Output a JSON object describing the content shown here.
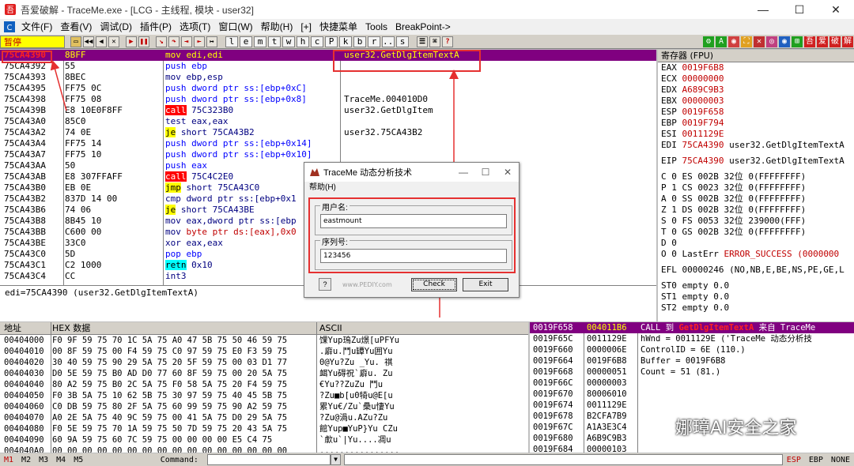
{
  "window": {
    "title": "吾爱破解 - TraceMe.exe - [LCG - 主线程, 模块 - user32]",
    "minimize": "—",
    "maximize": "☐",
    "close": "✕"
  },
  "menu": [
    "文件(F)",
    "查看(V)",
    "调试(D)",
    "插件(P)",
    "选项(T)",
    "窗口(W)",
    "帮助(H)",
    "[+]",
    "快捷菜单",
    "Tools",
    "BreakPoint->"
  ],
  "toolbar": {
    "status": "暂停",
    "nav_buttons": [
      "◀◀",
      "◀",
      "▶",
      "▶▶"
    ],
    "run_buttons": [
      "▶",
      "❚❚"
    ],
    "step_buttons": [
      "↘",
      "↷",
      "⇥",
      "⇤",
      "↦"
    ],
    "letters": [
      "l",
      "e",
      "m",
      "t",
      "w",
      "h",
      "c",
      "P",
      "k",
      "b",
      "r",
      "...",
      "s"
    ],
    "right_icons": [
      "☰",
      "⌘",
      "?"
    ],
    "plugin_icons": [
      "⚙",
      "A",
      "◉",
      "⛶",
      "✕",
      "◎",
      "◉",
      "⊞",
      "吾",
      "爱",
      "破",
      "解"
    ],
    "colors": {
      "purple_sel": "#800080",
      "addr_red": "#ff2020",
      "accent_red": "#e53030"
    }
  },
  "cpu": {
    "rows": [
      {
        "addr": "75CA4390",
        "hex": "8BFF",
        "mnem": "mov",
        "ops": "edi,edi",
        "comment": "user32.GetDlgItemTextA",
        "style": "nv",
        "sel": true
      },
      {
        "addr": "75CA4392",
        "hex": "55",
        "mnem": "push",
        "ops": "ebp",
        "comment": "",
        "style": "blue"
      },
      {
        "addr": "75CA4393",
        "hex": "8BEC",
        "mnem": "mov",
        "ops": "ebp,esp",
        "comment": "",
        "style": "nv"
      },
      {
        "addr": "75CA4395",
        "hex": "FF75 0C",
        "mnem": "push",
        "ops": "dword ptr ss:[ebp+0xC]",
        "comment": "",
        "style": "blue"
      },
      {
        "addr": "75CA4398",
        "hex": "FF75 08",
        "mnem": "push",
        "ops": "dword ptr ss:[ebp+0x8]",
        "comment": "TraceMe.004010D0",
        "style": "blue"
      },
      {
        "addr": "75CA439B",
        "hex": "E8 10E0F8FF",
        "mnem": "call",
        "ops": "75C323B0",
        "comment": "user32.GetDlgItem",
        "style": "call"
      },
      {
        "addr": "75CA43A0",
        "hex": "85C0",
        "mnem": "test",
        "ops": "eax,eax",
        "comment": "",
        "style": "nv"
      },
      {
        "addr": "75CA43A2",
        "hex": "74 0E",
        "mnem": "je",
        "ops": "short 75CA43B2",
        "comment": "user32.75CA43B2",
        "style": "jmp"
      },
      {
        "addr": "75CA43A4",
        "hex": "FF75 14",
        "mnem": "push",
        "ops": "dword ptr ss:[ebp+0x14]",
        "comment": "",
        "style": "blue"
      },
      {
        "addr": "75CA43A7",
        "hex": "FF75 10",
        "mnem": "push",
        "ops": "dword ptr ss:[ebp+0x10]",
        "comment": "",
        "style": "blue"
      },
      {
        "addr": "75CA43AA",
        "hex": "50",
        "mnem": "push",
        "ops": "eax",
        "comment": "",
        "style": "blue"
      },
      {
        "addr": "75CA43AB",
        "hex": "E8 307FFAFF",
        "mnem": "call",
        "ops": "75C4C2E0",
        "comment": "",
        "style": "call"
      },
      {
        "addr": "75CA43B0",
        "hex": "EB 0E",
        "mnem": "jmp",
        "ops": "short 75CA43C0",
        "comment": "",
        "style": "jmp"
      },
      {
        "addr": "75CA43B2",
        "hex": "837D 14 00",
        "mnem": "cmp",
        "ops": "dword ptr ss:[ebp+0x1",
        "comment": "",
        "style": "nv"
      },
      {
        "addr": "75CA43B6",
        "hex": "74 06",
        "mnem": "je",
        "ops": "short 75CA43BE",
        "comment": "",
        "style": "jmp"
      },
      {
        "addr": "75CA43B8",
        "hex": "8B45 10",
        "mnem": "mov",
        "ops": "eax,dword ptr ss:[ebp",
        "comment": "",
        "style": "nv"
      },
      {
        "addr": "75CA43BB",
        "hex": "C600 00",
        "mnem": "mov",
        "ops": "byte ptr ds:[eax],0x0",
        "comment": "",
        "style": "nvred"
      },
      {
        "addr": "75CA43BE",
        "hex": "33C0",
        "mnem": "xor",
        "ops": "eax,eax",
        "comment": "",
        "style": "nv"
      },
      {
        "addr": "75CA43C0",
        "hex": "5D",
        "mnem": "pop",
        "ops": "ebp",
        "comment": "",
        "style": "blue"
      },
      {
        "addr": "75CA43C1",
        "hex": "C2 1000",
        "mnem": "retn",
        "ops": "0x10",
        "comment": "",
        "style": "ret"
      },
      {
        "addr": "75CA43C4",
        "hex": "CC",
        "mnem": "int3",
        "ops": "",
        "comment": "",
        "style": "nv"
      }
    ],
    "info": "edi=75CA4390 (user32.GetDlgItemTextA)"
  },
  "registers": {
    "header": "寄存器 (FPU)",
    "gpr": [
      {
        "name": "EAX",
        "value": "0019F6B8",
        "comment": ""
      },
      {
        "name": "ECX",
        "value": "00000000",
        "comment": ""
      },
      {
        "name": "EDX",
        "value": "A689C9B3",
        "comment": ""
      },
      {
        "name": "EBX",
        "value": "00000003",
        "comment": ""
      },
      {
        "name": "ESP",
        "value": "0019F658",
        "comment": ""
      },
      {
        "name": "EBP",
        "value": "0019F794",
        "comment": ""
      },
      {
        "name": "ESI",
        "value": "0011129E",
        "comment": ""
      },
      {
        "name": "EDI",
        "value": "75CA4390",
        "comment": "user32.GetDlgItemTextA"
      }
    ],
    "eip": {
      "name": "EIP",
      "value": "75CA4390",
      "comment": "user32.GetDlgItemTextA"
    },
    "flags": [
      "C 0  ES 002B 32位 0(FFFFFFFF)",
      "P 1  CS 0023 32位 0(FFFFFFFF)",
      "A 0  SS 002B 32位 0(FFFFFFFF)",
      "Z 1  DS 002B 32位 0(FFFFFFFF)",
      "S 0  FS 0053 32位 239000(FFF)",
      "T 0  GS 002B 32位 0(FFFFFFFF)",
      "D 0"
    ],
    "lasterr_prefix": "O 0  LastErr ",
    "lasterr_value": "ERROR_SUCCESS (0000000",
    "efl": "EFL 00000246 (NO,NB,E,BE,NS,PE,GE,L",
    "st": [
      "ST0 empty 0.0",
      "ST1 empty 0.0",
      "ST2 empty 0.0"
    ]
  },
  "dump": {
    "col_addr": "地址",
    "col_hex": "HEX 数据",
    "col_ascii": "ASCII",
    "rows": [
      {
        "a": "00404000",
        "h": "F0 9F 59 75 70 1C 5A 75 A0 47 5B 75 50 46 59 75",
        "s": "馃Yup鳿Zu燝[uPFYu"
      },
      {
        "a": "00404010",
        "h": "00 8F 59 75 00 F4 59 75 C0 97 59 75 E0 F3 59 75",
        "s": ".廦u.鬥u罈Yu囲Yu"
      },
      {
        "a": "00404020",
        "h": "30 40 59 75 90 29 5A 75 20 5F 59 75 00 03 D1 77",
        "s": "0@Yu?Zu _Yu. 祺"
      },
      {
        "a": "00404030",
        "h": "D0 5E 59 75 B0 AD D0 77 60 8F 59 75 00 20 5A 75",
        "s": "衈Yu碍祝`廦u. Zu"
      },
      {
        "a": "00404040",
        "h": "80 A2 59 75 B0 2C 5A 75 F0 58 5A 75 20 F4 59 75",
        "s": "€Yu??ZuZu 鬥u"
      },
      {
        "a": "00404050",
        "h": "F0 3B 5A 75 10 62 5B 75 30 97 59 75 40 45 5B 75",
        "s": "?Zu■b[u0犄u@E[u"
      },
      {
        "a": "00404060",
        "h": "C0 DB 59 75 80 2F 5A 75 60 99 59 75 90 A2 59 75",
        "s": "累Yu€/Zu`櫐u悽Yu"
      },
      {
        "a": "00404070",
        "h": "A0 2E 5A 75 40 9C 59 75 00 41 5A 75 D0 29 5A 75",
        "s": "?Zu@渦u.AZu?Zu"
      },
      {
        "a": "00404080",
        "h": "F0 5E 59 75 70 1A 59 75 50 7D 59 75 20 43 5A 75",
        "s": "館Yup■YuP}Yu CZu"
      },
      {
        "a": "00404090",
        "h": "60 9A 59 75 60 7C 59 75 00 00 00 00 E5 C4 75",
        "s": "`歑u`|Yu....凋u"
      },
      {
        "a": "004040A0",
        "h": "00 00 00 00 00 00 00 00 00 00 00 00 00 00 00 00",
        "s": "................"
      }
    ]
  },
  "stack": {
    "rows": [
      {
        "a": "0019F658",
        "v": "004011B6",
        "c1": "CALL 到 ",
        "c2": "GetDlgItemTextA",
        "c3": " 来自 TraceMe",
        "sel": true
      },
      {
        "a": "0019F65C",
        "v": "0011129E",
        "c": "hWnd = 0011129E ('TraceMe 动态分析技"
      },
      {
        "a": "0019F660",
        "v": "0000006E",
        "c": "ControlID = 6E (110.)"
      },
      {
        "a": "0019F664",
        "v": "0019F6B8",
        "c": "Buffer = 0019F6B8"
      },
      {
        "a": "0019F668",
        "v": "00000051",
        "c": "Count = 51 (81.)"
      },
      {
        "a": "0019F66C",
        "v": "00000003",
        "c": ""
      },
      {
        "a": "0019F670",
        "v": "80006010",
        "c": ""
      },
      {
        "a": "0019F674",
        "v": "0011129E",
        "c": ""
      },
      {
        "a": "0019F678",
        "v": "B2CFA7B9",
        "c": ""
      },
      {
        "a": "0019F67C",
        "v": "A1A3E3C4",
        "c": ""
      },
      {
        "a": "0019F680",
        "v": "A6B9C9B3",
        "c": ""
      },
      {
        "a": "0019F684",
        "v": "00000103",
        "c": ""
      }
    ]
  },
  "statusbar": {
    "marks": [
      "M1",
      "M2",
      "M3",
      "M4",
      "M5"
    ],
    "command_label": "Command:",
    "right": [
      "ESP",
      "EBP",
      "NONE"
    ]
  },
  "dialog": {
    "title": "TraceMe 动态分析技术",
    "menu": "帮助(H)",
    "user_label": "用户名:",
    "user_value": "eastmount",
    "serial_label": "序列号:",
    "serial_value": "123456",
    "help_btn": "?",
    "url": "www.PEDIY.com",
    "check": "Check",
    "exit": "Exit"
  },
  "watermark": "娜璋AI安全之家"
}
